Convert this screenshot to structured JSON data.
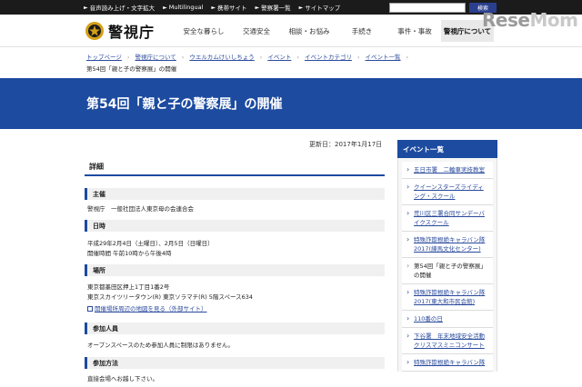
{
  "utility": {
    "links": [
      {
        "label": "音声読み上げ・文字拡大"
      },
      {
        "label": "Multilingual"
      },
      {
        "label": "携帯サイト"
      },
      {
        "label": "警察署一覧"
      },
      {
        "label": "サイトマップ"
      }
    ],
    "search_button": "検索"
  },
  "header": {
    "logo_text": "警視庁",
    "nav": [
      {
        "label": "安全な暮らし"
      },
      {
        "label": "交通安全"
      },
      {
        "label": "相談・お悩み"
      },
      {
        "label": "手続き"
      },
      {
        "label": "事件・事故"
      },
      {
        "label": "警視庁について"
      }
    ]
  },
  "watermark": {
    "text_a": "Rese",
    "text_b": "Mom"
  },
  "breadcrumb": {
    "items": [
      "トップページ",
      "警視庁について",
      "ウエルカムけいしちょう",
      "イベント",
      "イベントカテゴリ",
      "イベント一覧"
    ],
    "current": "第54回「親と子の警察展」の開催"
  },
  "page": {
    "title": "第54回「親と子の警察展」の開催",
    "updated": "更新日：2017年1月17日"
  },
  "details": {
    "heading": "詳細",
    "sections": [
      {
        "title": "主催",
        "lines": [
          "警視庁　一般社団法人東京母の会連合会"
        ]
      },
      {
        "title": "日時",
        "lines": [
          "平成29年2月4日（土曜日）、2月5日（日曜日）",
          "開催時間 午前10時から午後4時"
        ]
      },
      {
        "title": "場所",
        "lines": [
          "東京都墨田区押上1丁目1番2号",
          "東京スカイツリータウン(R) 東京ソラマチ(R) 5階スペース634"
        ],
        "link": "開催場所周辺の地図を見る（外部サイト）"
      },
      {
        "title": "参加人員",
        "lines": [
          "オープンスペースのため参加人員に制限はありません。"
        ]
      },
      {
        "title": "参加方法",
        "lines": [
          "直接会場へお越し下さい。"
        ]
      }
    ]
  },
  "sidebar": {
    "heading": "イベント一覧",
    "items": [
      {
        "label": "五日市署　二輪車実技教室"
      },
      {
        "label": "クイーンスターズライディング・スクール"
      },
      {
        "label": "荒川区三署合同サンデーバイクスクール"
      },
      {
        "label": "特殊詐欺根絶キャラバン隊2017(練馬文化センター)"
      },
      {
        "label": "第54回「親と子の警察展」の開催"
      },
      {
        "label": "特殊詐欺根絶キャラバン隊2017(東大和市民会館)"
      },
      {
        "label": "110番の日"
      },
      {
        "label": "下谷署　年末地域安全活動クリスマスミニコンサート"
      },
      {
        "label": "特殊詐欺根絶キャラバン隊"
      }
    ]
  }
}
